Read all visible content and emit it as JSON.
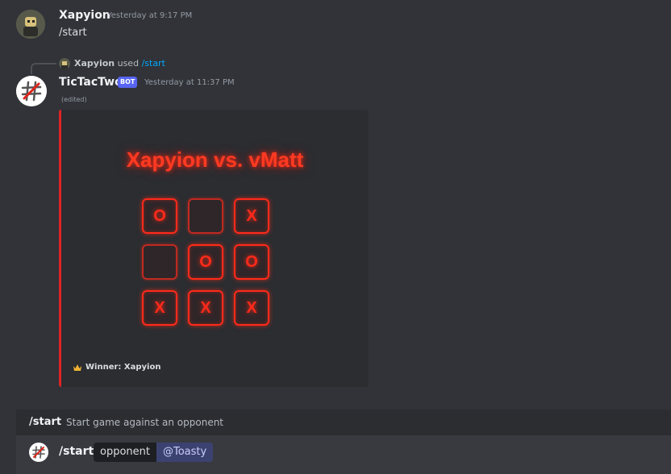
{
  "messages": {
    "first": {
      "username": "Xapyion",
      "timestamp": "Yesterday at 9:17 PM",
      "text": "/start"
    },
    "reply": {
      "user": "Xapyion",
      "used": "used",
      "command": "/start"
    },
    "bot": {
      "username": "TicTacTwo",
      "tag": "BOT",
      "timestamp": "Yesterday at 11:37 PM",
      "edited": "(edited)"
    }
  },
  "embed": {
    "title": "Xapyion vs. vMatt",
    "board": [
      "O",
      "",
      "X",
      "",
      "O",
      "O",
      "X",
      "X",
      "X"
    ],
    "footer_icon": "crown-icon",
    "footer": "Winner: Xapyion",
    "accent_color": "#e02424"
  },
  "suggestion": {
    "command": "/start",
    "description": "Start game against an opponent"
  },
  "input": {
    "command": "/start",
    "option_name": "opponent",
    "option_value": "@Toasty"
  }
}
